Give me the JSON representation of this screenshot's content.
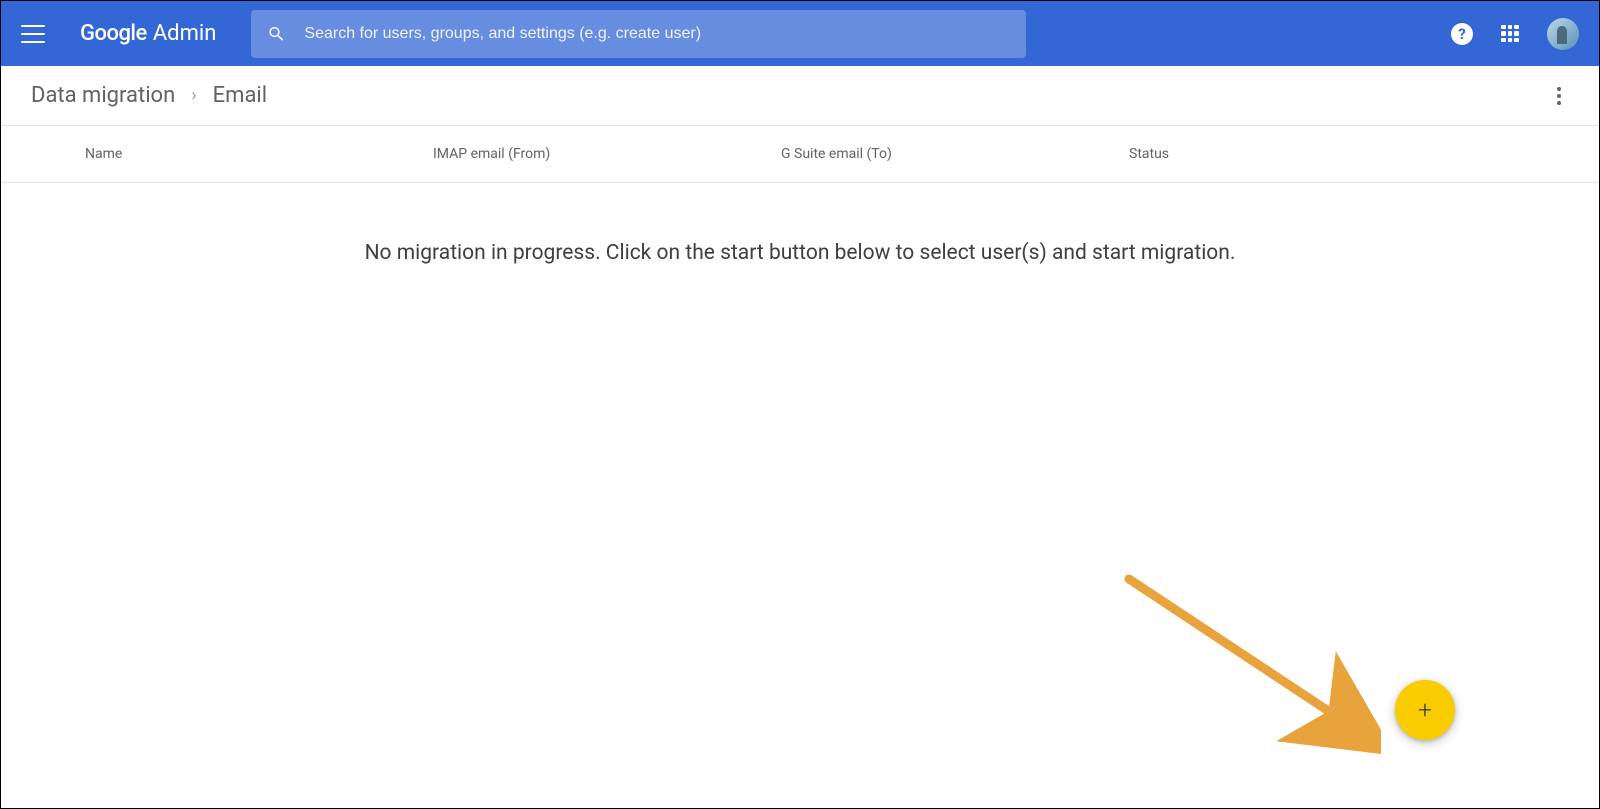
{
  "header": {
    "logo_brand": "Google",
    "logo_product": "Admin",
    "search_placeholder": "Search for users, groups, and settings (e.g. create user)"
  },
  "breadcrumb": {
    "parent": "Data migration",
    "current": "Email"
  },
  "table": {
    "columns": {
      "name": "Name",
      "from": "IMAP email (From)",
      "to": "G Suite email (To)",
      "status": "Status"
    }
  },
  "main": {
    "empty_message": "No migration in progress. Click on the start button below to select user(s) and start migration."
  },
  "fab": {
    "label": "+"
  }
}
